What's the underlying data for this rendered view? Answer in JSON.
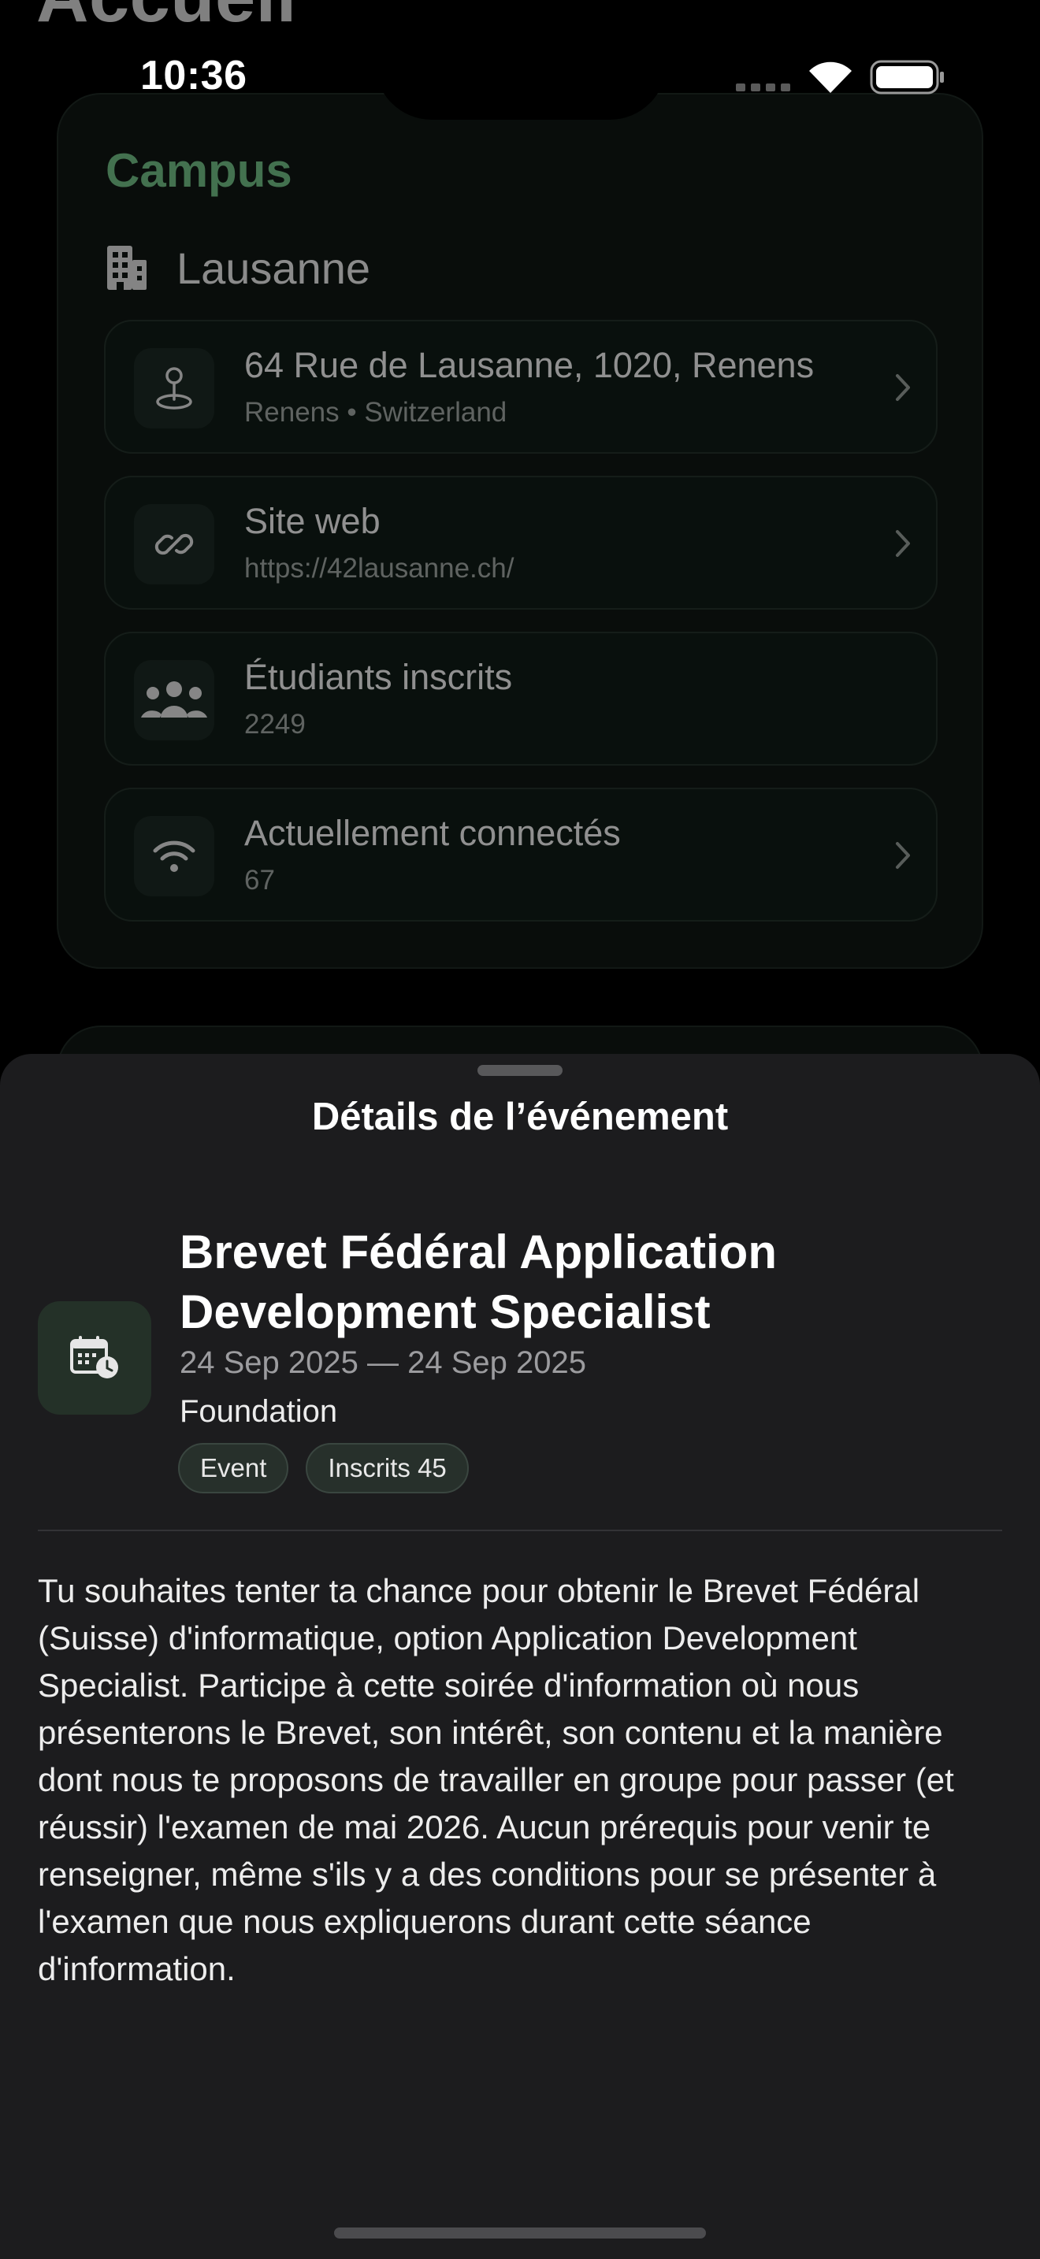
{
  "status_bar": {
    "time": "10:36"
  },
  "background_page": {
    "title": "Accueil",
    "campus": {
      "heading": "Campus",
      "city": "Lausanne",
      "rows": [
        {
          "icon": "map-pin-icon",
          "title": "64 Rue de Lausanne, 1020, Renens",
          "subtitle": "Renens • Switzerland",
          "has_chevron": true
        },
        {
          "icon": "link-icon",
          "title": "Site web",
          "subtitle": "https://42lausanne.ch/",
          "has_chevron": true
        },
        {
          "icon": "people-icon",
          "title": "Étudiants inscrits",
          "subtitle": "2249",
          "has_chevron": false
        },
        {
          "icon": "wifi-icon",
          "title": "Actuellement connectés",
          "subtitle": "67",
          "has_chevron": true
        }
      ]
    }
  },
  "sheet": {
    "title": "Détails de l’événement",
    "event": {
      "icon": "calendar-clock-icon",
      "name": "Brevet Fédéral Application Development Specialist",
      "dates": "24 Sep 2025 — 24 Sep 2025",
      "category": "Foundation",
      "chips": [
        "Event",
        "Inscrits 45"
      ],
      "description": "Tu souhaites tenter ta chance pour obtenir le Brevet Fédéral (Suisse) d'informatique, option Application Development Specialist. Participe à cette soirée d'information où nous présenterons le Brevet, son intérêt, son contenu et la manière dont nous te proposons de travailler en groupe pour passer (et réussir) l'examen de mai 2026. Aucun prérequis pour venir te renseigner, même s'ils y a des conditions pour se présenter à l'examen que nous expliquerons durant cette séance d'information."
    }
  },
  "colors": {
    "accent_green": "#6db680",
    "card_background": "#0f1613",
    "sheet_background": "#1c1c1e"
  }
}
